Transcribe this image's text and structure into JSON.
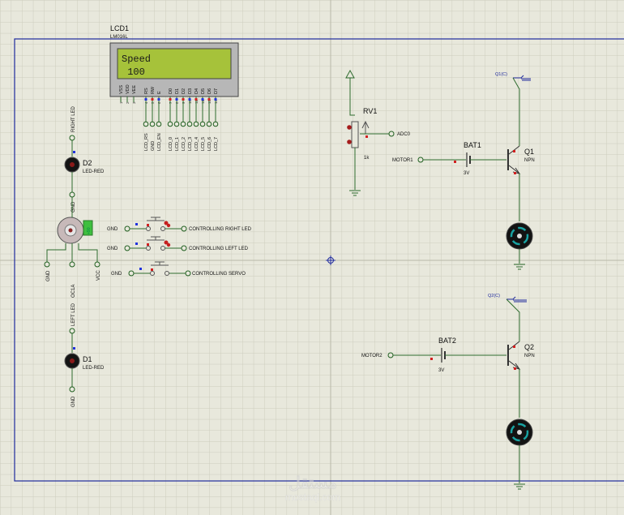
{
  "lcd": {
    "ref": "LCD1",
    "part": "LM016L",
    "line1": "Speed",
    "line2": " 100",
    "pins": [
      "VSS",
      "VDD",
      "VEE",
      "RS",
      "RW",
      "E",
      "D0",
      "D1",
      "D2",
      "D3",
      "D4",
      "D5",
      "D6",
      "D7"
    ],
    "pin_nums": [
      "1",
      "2",
      "3",
      "4",
      "5",
      "6",
      "7",
      "8",
      "9",
      "10",
      "11",
      "12",
      "13",
      "14"
    ],
    "nets": [
      "LCD_RS",
      "GND",
      "LCD_EN",
      "LCD_0",
      "LCD_1",
      "LCD_2",
      "LCD_3",
      "LCD_4",
      "LCD_5",
      "LCD_6",
      "LCD_7"
    ]
  },
  "d2": {
    "ref": "D2",
    "part": "LED-RED",
    "top_net": "RIGHT LED",
    "bottom_net": "GND"
  },
  "d1": {
    "ref": "D1",
    "part": "LED-RED",
    "top_net": "LEFT LED",
    "bottom_net": "GND"
  },
  "servo": {
    "nets": [
      "GND",
      "OC1A",
      "VCC"
    ]
  },
  "buttons": [
    {
      "gnd": "GND",
      "net": "CONTROLLING RIGHT LED"
    },
    {
      "gnd": "GND",
      "net": "CONTROLLING LEFT LED"
    },
    {
      "gnd": "GND",
      "net": "CONTROLLING SERVO"
    }
  ],
  "rv1": {
    "ref": "RV1",
    "value": "1k",
    "net": "ADC0"
  },
  "bat1": {
    "ref": "BAT1",
    "value": "3V",
    "net": "MOTOR1"
  },
  "bat2": {
    "ref": "BAT2",
    "value": "3V",
    "net": "MOTOR2"
  },
  "q1": {
    "ref": "Q1",
    "type": "NPN",
    "probe": "Q1(C)"
  },
  "q2": {
    "ref": "Q2",
    "type": "NPN",
    "probe": "Q2(C)"
  },
  "watermark": {
    "brand": "مستقل",
    "url": "mostaql.com"
  },
  "colors": {
    "background": "#e8e8dc",
    "grid": "#cfcfc0",
    "frame": "#1f2a9c",
    "wire": "#2e6b2e",
    "lcd_screen": "#a8c23c",
    "lcd_body": "#b8b8b8",
    "led": "#141414",
    "pin_red": "#d22020",
    "pin_blue": "#2233dd"
  }
}
